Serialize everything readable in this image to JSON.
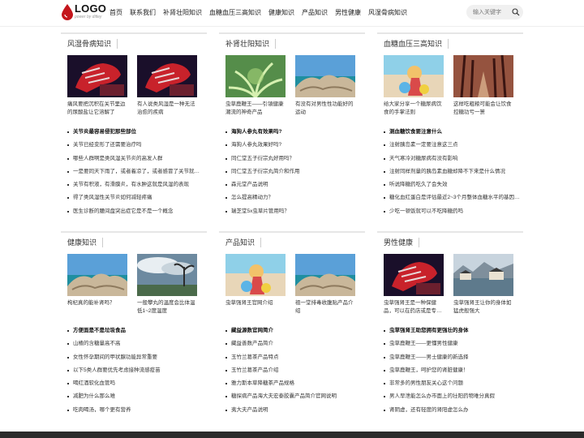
{
  "header": {
    "logo_text": "LOGO",
    "logo_sub": "power by ditley",
    "nav": [
      "首页",
      "联系我们",
      "补肾壮阳知识",
      "血糖血压三高知识",
      "健康知识",
      "产品知识",
      "男性健康",
      "风湿骨病知识"
    ],
    "search_placeholder": "输入关键字"
  },
  "colors": {
    "accent": "#c4161c",
    "footer": "#2b2b2b"
  },
  "cards": [
    {
      "title": "风湿骨病知识",
      "items": [
        {
          "caption": "痛风要把沉积在关节里边的尿酸盐让它溶解了",
          "image": "red-gloves"
        },
        {
          "caption": "有人说类风湿是一种无法治愈的疾病",
          "image": "red-gloves"
        }
      ],
      "list": [
        "关节炎最容易侵犯那些部位",
        "关节已经变形了还需要治疗吗",
        "哪些人群啊是类风湿关节炎的高发人群",
        "一是要同天下雨了，或者着凉了，或者感冒了关节就…",
        "关节有积液，有滑膜炎，有水肿这就是风湿的表现",
        "得了类风湿性关节炎如何减轻疼痛",
        "医生诊断的腰间盘突出症它是不是一个概念"
      ]
    },
    {
      "title": "补肾壮阳知识",
      "items": [
        {
          "caption": "虫草鹿鞭王——引領健康潮流的神奇产品",
          "image": "green-plant"
        },
        {
          "caption": "有没有对男性性功能好的运动",
          "image": "coast-rocks"
        }
      ],
      "list": [
        "海狗人参丸有效果吗?",
        "海狗人参丸效果好吗?",
        "同仁堂五子衍宗丸好用吗？",
        "同仁堂五子衍宗丸简介和作用",
        "森元堂产品说明",
        "怎么提高精动力？",
        "瑞芝堂5x虫草片管用吗？"
      ]
    },
    {
      "title": "血糖血压三高知识",
      "items": [
        {
          "caption": "给大家分享一个糖尿病饮食的手掌法则",
          "image": "beach-girl"
        },
        {
          "caption": "这样吃粗粮可能会让饮食控糖功亏一篑",
          "image": "tree-path"
        }
      ],
      "list": [
        "测血糖饮食要注意什么",
        "注射胰岛素一定要注意这三点",
        "天气寒冷对糖尿病有没有影响",
        "注射同样剂量的胰岛素血糖却降不下来是什么情况",
        "听说降糖药吃久了会失效",
        "糖化血红蛋白是评估最近2~3个月整体血糖水平的基因…",
        "少吃一顿饭就可以不吃降糖药吗"
      ]
    },
    {
      "title": "健康知识",
      "items": [
        {
          "caption": "枸杞真的能补肾吗？",
          "image": "coast-rocks"
        },
        {
          "caption": "一般攀丸的温度会比体温低1~2度温度",
          "image": "storm-tree"
        }
      ],
      "list": [
        "方便面是不是垃圾食品",
        "山楂的含糖量高不高",
        "女性怀孕期间的甲状腺功能异常重要",
        "以下5类人群要优先考虑接种流感疫苗",
        "喝红酒软化血管吗",
        "减肥为什么那么难",
        "吃肉喝汤，哪个更有营养"
      ]
    },
    {
      "title": "产品知识",
      "items": [
        {
          "caption": "虫草强肾王官网介绍",
          "image": "beach-girl"
        },
        {
          "caption": "祖一堂排毒收腹贴产品介绍",
          "image": "coast-rocks"
        }
      ],
      "list": [
        "藏益源数官网简介",
        "藏益善数产品简介",
        "玉竹兰葛茶产品特点",
        "玉竹兰葛茶产品介绍",
        "雅力斯本草降糖茶产品规格",
        "糖探病产品海大夫宏泰胶囊产品简介官网说明",
        "夷大夫产品说明"
      ]
    },
    {
      "title": "男性健康",
      "items": [
        {
          "caption": "虫草强肾王是一种保健品，可以在药店或是专…",
          "image": "red-gloves"
        },
        {
          "caption": "虫草强肾王让你的身体如猛虎般强大",
          "image": "village-lake"
        }
      ],
      "list": [
        "虫草强肾王助您拥有更强壮的身体",
        "虫草鹿鞭王——更懂男性健康",
        "虫草鹿鞭王——男士健康的新选择",
        "虫草鹿鞭王，呵护您的肾脏健康！",
        "非常多的男性朋友关心这个问题",
        "男人早泄能怎么办市面上的壮阳药物难分真假",
        "肾阴虚，还有轻度的肾阳虚怎么办"
      ]
    }
  ]
}
